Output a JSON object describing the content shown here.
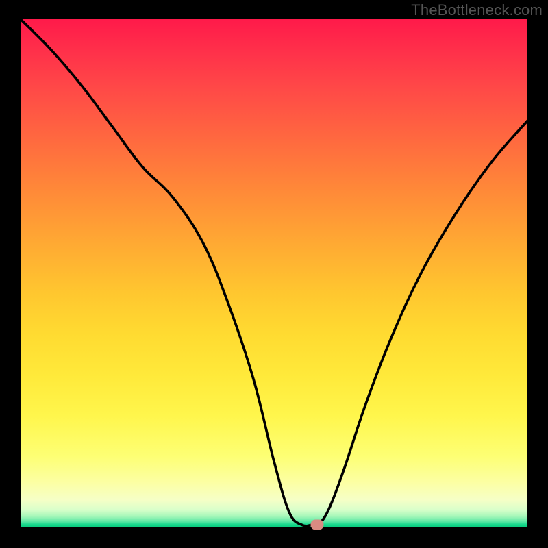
{
  "watermark": "TheBottleneck.com",
  "colors": {
    "border": "#000000",
    "curve": "#000000",
    "marker": "#d98b82",
    "gradient_stops": [
      "#ff1a4a",
      "#ff4a47",
      "#ff8a38",
      "#ffc72f",
      "#ffe93a",
      "#fcffa2",
      "#a6f7b9",
      "#06c97a"
    ]
  },
  "chart_data": {
    "type": "line",
    "title": "",
    "xlabel": "",
    "ylabel": "",
    "xlim": [
      0,
      100
    ],
    "ylim": [
      0,
      100
    ],
    "series": [
      {
        "name": "bottleneck-curve",
        "x": [
          0,
          6,
          12,
          18,
          24,
          30,
          36,
          41,
          46,
          50,
          53,
          55.5,
          57.5,
          59,
          61,
          64,
          68,
          73,
          79,
          86,
          93,
          100
        ],
        "values": [
          100,
          94,
          87,
          79,
          71,
          65,
          56,
          44,
          29,
          13,
          3,
          0.5,
          0.5,
          0.8,
          4,
          12,
          24,
          37,
          50,
          62,
          72,
          80
        ]
      }
    ],
    "annotations": [
      {
        "name": "optimal-marker",
        "x": 58.5,
        "y": 0.6
      }
    ],
    "note": "x and y are in percent of plot area; y is measured from bottom (0=bottom, 100=top). V-shaped curve with flat minimum near x≈56–58%; marker sits at the valley floor."
  }
}
